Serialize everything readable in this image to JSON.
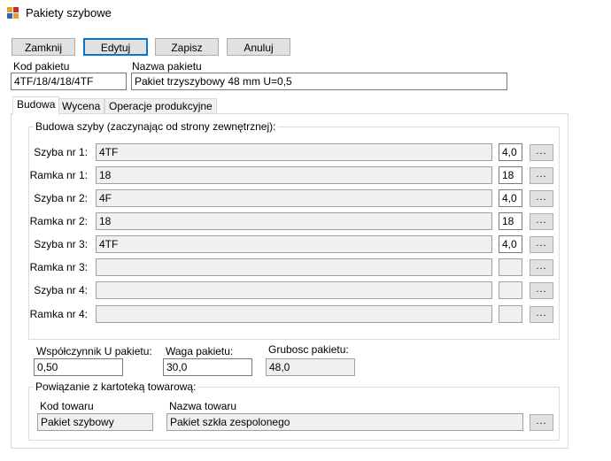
{
  "window": {
    "title": "Pakiety szybowe",
    "icon": "app-grid-icon"
  },
  "toolbar": {
    "close_label": "Zamknij",
    "edit_label": "Edytuj",
    "save_label": "Zapisz",
    "cancel_label": "Anuluj"
  },
  "header": {
    "code_label": "Kod pakietu",
    "code_value": "4TF/18/4/18/4TF",
    "name_label": "Nazwa pakietu",
    "name_value": "Pakiet trzyszybowy 48 mm U=0,5"
  },
  "tabs": [
    {
      "label": "Budowa",
      "active": true
    },
    {
      "label": "Wycena",
      "active": false
    },
    {
      "label": "Operacje produkcyjne",
      "active": false
    }
  ],
  "structure": {
    "group_title": "Budowa szyby (zaczynając od strony zewnętrznej):",
    "rows": [
      {
        "label": "Szyba nr 1:",
        "value": "4TF",
        "thickness": "4,0"
      },
      {
        "label": "Ramka nr 1:",
        "value": "18",
        "thickness": "18"
      },
      {
        "label": "Szyba nr 2:",
        "value": "4F",
        "thickness": "4,0"
      },
      {
        "label": "Ramka nr 2:",
        "value": "18",
        "thickness": "18"
      },
      {
        "label": "Szyba nr 3:",
        "value": "4TF",
        "thickness": "4,0"
      },
      {
        "label": "Ramka nr 3:",
        "value": "",
        "thickness": ""
      },
      {
        "label": "Szyba nr 4:",
        "value": "",
        "thickness": ""
      },
      {
        "label": "Ramka nr 4:",
        "value": "",
        "thickness": ""
      }
    ],
    "browse_label": "..."
  },
  "properties": {
    "u_label": "Współczynnik U pakietu:",
    "u_value": "0,50",
    "weight_label": "Waga pakietu:",
    "weight_value": "30,0",
    "thickness_label": "Grubosc pakietu:",
    "thickness_value": "48,0"
  },
  "link": {
    "group_title": "Powiązanie z kartoteką towarową:",
    "product_code_label": "Kod towaru",
    "product_code_value": "Pakiet szybowy",
    "product_name_label": "Nazwa towaru",
    "product_name_value": "Pakiet szkła zespolonego",
    "browse_label": "..."
  }
}
